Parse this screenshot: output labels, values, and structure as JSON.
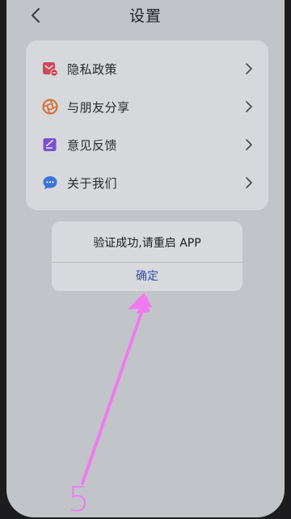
{
  "header": {
    "title": "设置"
  },
  "menu": {
    "items": [
      {
        "label": "隐私政策",
        "icon": "privacy-shield-icon"
      },
      {
        "label": "与朋友分享",
        "icon": "share-aperture-icon"
      },
      {
        "label": "意见反馈",
        "icon": "feedback-edit-icon"
      },
      {
        "label": "关于我们",
        "icon": "chat-bubble-icon"
      }
    ]
  },
  "dialog": {
    "message": "验证成功,请重启 APP",
    "confirm_label": "确定"
  },
  "annotation": {
    "step_number": "5",
    "color": "#f07af0"
  },
  "colors": {
    "background": "#c1c4c9",
    "card": "#d7d8dc",
    "dialog": "#d9dadd",
    "link": "#2a4fa8"
  }
}
